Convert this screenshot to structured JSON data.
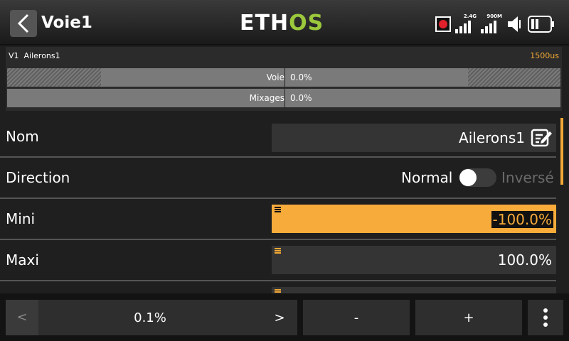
{
  "header": {
    "title": "Voie1",
    "logo": {
      "part1": "ETH",
      "part2": "OS"
    },
    "signal_24": "2.4G",
    "signal_900": "900M"
  },
  "channel": {
    "label": "V1  Ailerons1",
    "value": "1500us",
    "bars": [
      {
        "name": "Voie",
        "value": "0.0%"
      },
      {
        "name": "Mixages",
        "value": "0.0%"
      }
    ]
  },
  "form": {
    "name_label": "Nom",
    "name_value": "Ailerons1",
    "direction_label": "Direction",
    "direction_normal": "Normal",
    "direction_inverse": "Inversé",
    "direction_inverted": false,
    "min_label": "Mini",
    "min_value": "-100.0%",
    "max_label": "Maxi",
    "max_value": "100.0%"
  },
  "toolbar": {
    "prev": "<",
    "step": "0.1%",
    "next": ">",
    "minus": "-",
    "plus": "+"
  },
  "colors": {
    "accent": "#f7ab3a",
    "logo_green": "#9bc83c",
    "record": "#e0202a"
  }
}
